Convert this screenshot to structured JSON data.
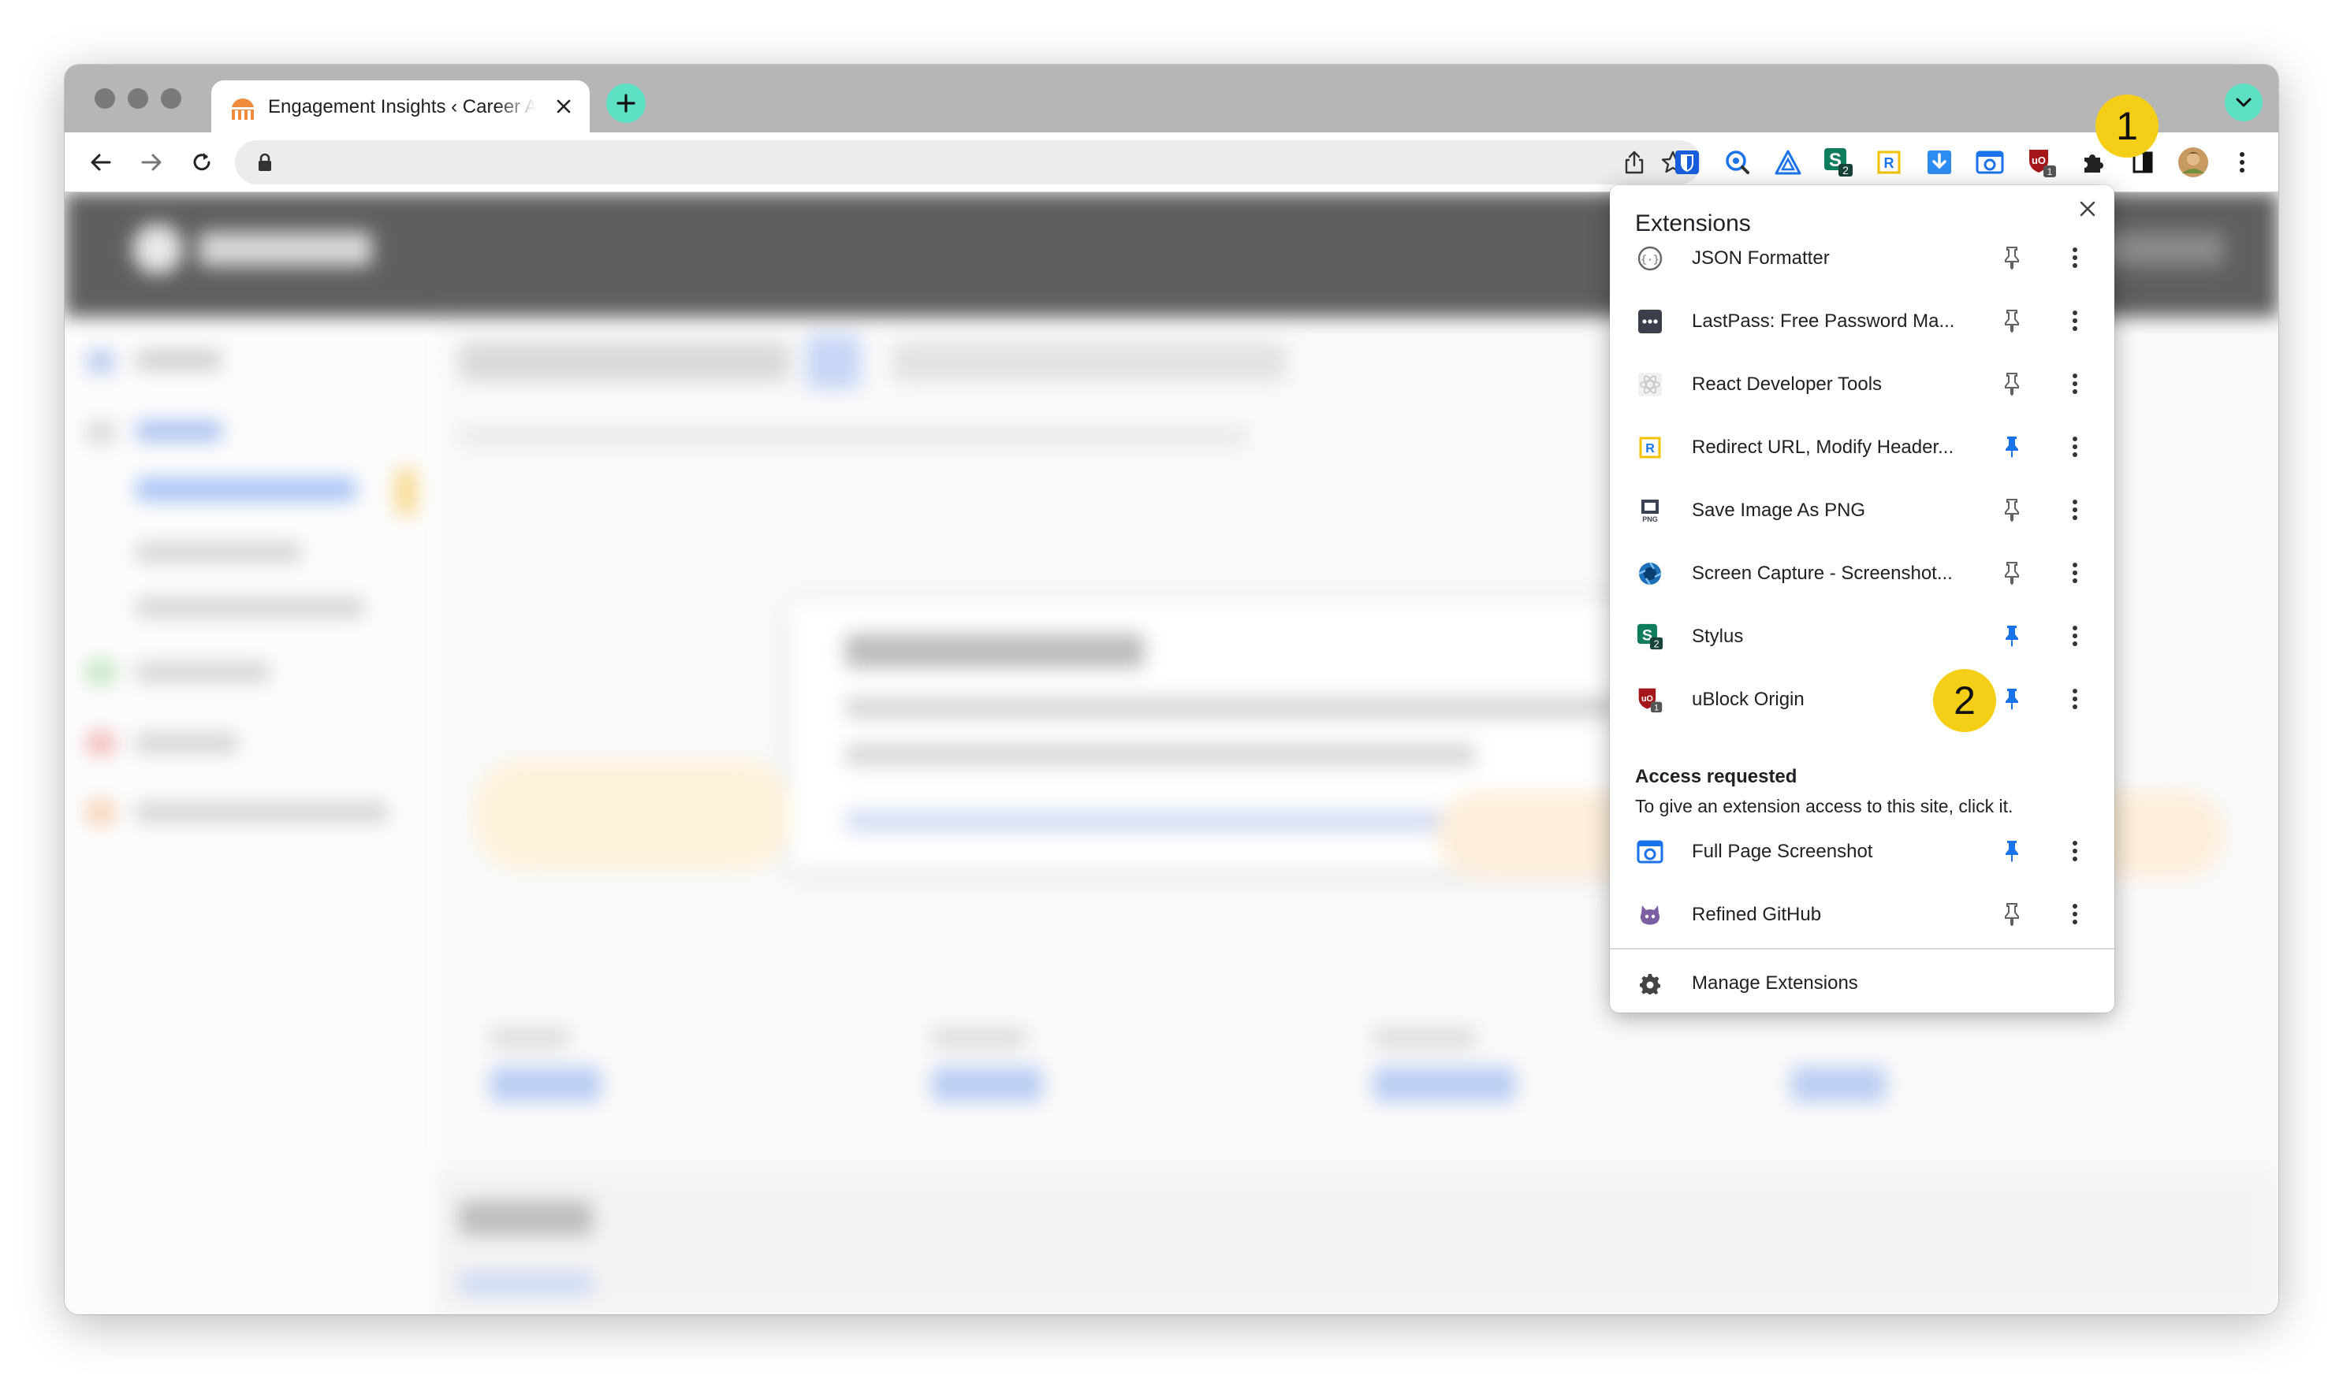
{
  "browser": {
    "tab_title": "Engagement Insights ‹ Career Advisor",
    "new_tab_icon": "plus-icon",
    "tab_search_icon": "chevron-down-icon"
  },
  "toolbar": {
    "back_icon": "back-arrow-icon",
    "forward_icon": "forward-arrow-icon",
    "reload_icon": "reload-icon",
    "omnibox_value": "",
    "toolbar_extensions": [
      "bitwarden",
      "lastpass-mini",
      "stylus-ish",
      "vue",
      "stylus",
      "redirect",
      "downloads",
      "full-page-screenshot",
      "ublock",
      "extensions-puzzle",
      "sidebar",
      "profile"
    ]
  },
  "popup": {
    "title": "Extensions",
    "extensions": [
      {
        "name": "JSON Formatter",
        "icon": "json-formatter-icon",
        "pinned": false
      },
      {
        "name": "LastPass: Free Password Ma...",
        "icon": "lastpass-icon",
        "pinned": false
      },
      {
        "name": "React Developer Tools",
        "icon": "react-icon",
        "pinned": false
      },
      {
        "name": "Redirect URL, Modify Header...",
        "icon": "redirect-icon",
        "pinned": true
      },
      {
        "name": "Save Image As PNG",
        "icon": "save-png-icon",
        "pinned": false
      },
      {
        "name": "Screen Capture - Screenshot...",
        "icon": "screen-capture-icon",
        "pinned": false
      },
      {
        "name": "Stylus",
        "icon": "stylus-icon",
        "pinned": true
      },
      {
        "name": "uBlock Origin",
        "icon": "ublock-icon",
        "pinned": true
      }
    ],
    "access_heading": "Access requested",
    "access_subtitle": "To give an extension access to this site, click it.",
    "access_extensions": [
      {
        "name": "Full Page Screenshot",
        "icon": "full-page-screenshot-icon",
        "pinned": true
      },
      {
        "name": "Refined GitHub",
        "icon": "refined-github-icon",
        "pinned": false
      }
    ],
    "manage_label": "Manage Extensions"
  },
  "callouts": {
    "one": "1",
    "two": "2"
  },
  "colors": {
    "pin_active": "#1a73e8",
    "pin_inactive": "#5f6368",
    "callout": "#f5cf17",
    "accent_tab": "#5ee0c4"
  }
}
